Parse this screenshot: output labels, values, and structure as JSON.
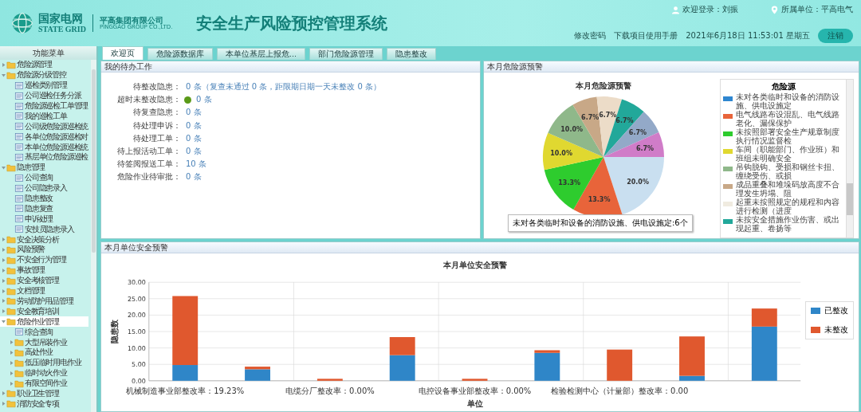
{
  "header": {
    "brand_cn": "国家电网",
    "brand_en": "STATE GRID",
    "company_cn": "平高集团有限公司",
    "company_en": "PINGGAO GROUP CO.,LTD.",
    "title": "安全生产风险预控管理系统",
    "user": "欢迎登录：刘振",
    "unit": "所属单位：平高电气",
    "links": [
      "修改密码",
      "下载项目使用手册"
    ],
    "datetime": "2021年6月18日 11:53:01 星期五",
    "logout": "注销"
  },
  "sidebar": {
    "title": "功能菜单",
    "items": [
      {
        "label": "危险源管理",
        "kind": "folder",
        "expanded": false,
        "selected": false
      },
      {
        "label": "危险源分级管控",
        "kind": "folder",
        "expanded": true,
        "selected": false,
        "children": [
          {
            "label": "巡检类别管理",
            "kind": "page",
            "selected": false
          },
          {
            "label": "公司巡检任务分派",
            "kind": "page",
            "selected": false
          },
          {
            "label": "危险源巡检工单管理",
            "kind": "page",
            "selected": false
          },
          {
            "label": "我的巡检工单",
            "kind": "page",
            "selected": false
          },
          {
            "label": "公司级危险源巡检统",
            "kind": "page",
            "selected": false
          },
          {
            "label": "各单位危险源巡检对",
            "kind": "page",
            "selected": false
          },
          {
            "label": "本单位危险源巡检统",
            "kind": "page",
            "selected": false
          },
          {
            "label": "基层单位危险源巡检",
            "kind": "page",
            "selected": false
          }
        ]
      },
      {
        "label": "隐患管理",
        "kind": "folder",
        "expanded": true,
        "selected": false,
        "children": [
          {
            "label": "公司查询",
            "kind": "page",
            "selected": false
          },
          {
            "label": "公司隐患录入",
            "kind": "page",
            "selected": false
          },
          {
            "label": "隐患整改",
            "kind": "page",
            "selected": false
          },
          {
            "label": "隐患复查",
            "kind": "page",
            "selected": false
          },
          {
            "label": "申诉处理",
            "kind": "page",
            "selected": false
          },
          {
            "label": "安技员隐患录入",
            "kind": "page",
            "selected": false
          }
        ]
      },
      {
        "label": "安全决策分析",
        "kind": "folder",
        "expanded": false,
        "selected": false
      },
      {
        "label": "风险预警",
        "kind": "folder",
        "expanded": false,
        "selected": false
      },
      {
        "label": "不安全行为管理",
        "kind": "folder",
        "expanded": false,
        "selected": false
      },
      {
        "label": "事故管理",
        "kind": "folder",
        "expanded": false,
        "selected": false
      },
      {
        "label": "安全考核管理",
        "kind": "folder",
        "expanded": false,
        "selected": false
      },
      {
        "label": "文档管理",
        "kind": "folder",
        "expanded": false,
        "selected": false
      },
      {
        "label": "劳动防护用品管理",
        "kind": "folder",
        "expanded": false,
        "selected": false
      },
      {
        "label": "安全教育培训",
        "kind": "folder",
        "expanded": false,
        "selected": false
      },
      {
        "label": "危险作业管理",
        "kind": "folder",
        "expanded": true,
        "selected": true,
        "children": [
          {
            "label": "综合查询",
            "kind": "page",
            "selected": false
          },
          {
            "label": "大型吊装作业",
            "kind": "folder",
            "expanded": false,
            "selected": false
          },
          {
            "label": "高处作业",
            "kind": "folder",
            "expanded": false,
            "selected": false
          },
          {
            "label": "低压临时用电作业",
            "kind": "folder",
            "expanded": false,
            "selected": false
          },
          {
            "label": "临时动火作业",
            "kind": "folder",
            "expanded": false,
            "selected": false
          },
          {
            "label": "有限空间作业",
            "kind": "folder",
            "expanded": false,
            "selected": false
          }
        ]
      },
      {
        "label": "职业卫生管理",
        "kind": "folder",
        "expanded": false,
        "selected": false
      },
      {
        "label": "消防安全专项",
        "kind": "folder",
        "expanded": false,
        "selected": false
      }
    ]
  },
  "tabs": [
    {
      "label": "欢迎页",
      "selected": true
    },
    {
      "label": "危险源数据库",
      "selected": false
    },
    {
      "label": "本单位基层上报危...",
      "selected": false
    },
    {
      "label": "部门危险源管理",
      "selected": false
    },
    {
      "label": "隐患整改",
      "selected": false
    }
  ],
  "todo": {
    "title": "我的待办工作",
    "rows": [
      {
        "label": "待整改隐患：",
        "value": "0 条（复查未通过 0 条，距限期日期一天未整改 0 条）",
        "alert": false
      },
      {
        "label": "超时未整改隐患：",
        "value": "0 条",
        "alert": true
      },
      {
        "label": "待复查隐患：",
        "value": "0 条",
        "alert": false
      },
      {
        "label": "待处理申诉：",
        "value": "0 条",
        "alert": false
      },
      {
        "label": "待处理工单：",
        "value": "0 条",
        "alert": false
      },
      {
        "label": "待上报活动工单：",
        "value": "0 条",
        "alert": false
      },
      {
        "label": "待签阅报送工单：",
        "value": "10 条",
        "alert": false
      },
      {
        "label": "危险作业待审批：",
        "value": "0 条",
        "alert": false
      }
    ]
  },
  "hazard_panel": {
    "title": "本月危险源预警",
    "chart_data": {
      "type": "pie",
      "title": "本月危险源预警",
      "values": [
        20.0,
        13.3,
        13.3,
        10.0,
        10.0,
        6.7,
        6.7,
        6.7,
        6.7,
        6.7
      ],
      "colors": [
        "#c9dff0",
        "#e8643a",
        "#2ecc2e",
        "#e0d830",
        "#8fb88a",
        "#c8a887",
        "#ecdcc8",
        "#22a89a",
        "#93a9c8",
        "#d07cc8"
      ],
      "value_labels": [
        "20.0%",
        "13.3%",
        "13.3%",
        "10.0%",
        "10.0%",
        "6.7%",
        "6.7%",
        "6.7%",
        "6.7%",
        "6.7%"
      ]
    },
    "tooltip": "未对各类临时和设备的消防设施、供电设施定:6个",
    "legend": {
      "title": "危险源",
      "items": [
        {
          "label": "未对各类临时和设备的消防设施、供电设施定",
          "color": "#2e86d0"
        },
        {
          "label": "电气线路布设混乱、电气线路老化、漏保保护",
          "color": "#e8643a"
        },
        {
          "label": "未按照部署安全生产规章制度执行情况监督检",
          "color": "#2ecc2e"
        },
        {
          "label": "车间（职能部门、作业班）和班组未明确安全",
          "color": "#e0d830"
        },
        {
          "label": "吊钩脱钩、受损和钢丝卡扭、缠绕受伤、或损",
          "color": "#8fb88a"
        },
        {
          "label": "成品重叠和堆垛码放高度不合理发生坍塌、阻",
          "color": "#c8a887"
        },
        {
          "label": "起重未按照规定的规程和内容进行检测（进度",
          "color": "#f0ebe0"
        },
        {
          "label": "未按安全措施作业伤害、或出现起重、卷扬等",
          "color": "#22a89a"
        }
      ]
    }
  },
  "unit_panel": {
    "title": "本月单位安全预警",
    "chart_data": {
      "type": "bar",
      "title": "本月单位安全预警",
      "xlabel": "单位",
      "ylabel": "隐患数",
      "stacked": true,
      "grid": true,
      "legend": true,
      "categories": [
        "机械制造事业部整改率：19.23%",
        null,
        "电缆分厂整改率：0.00%",
        null,
        "电控设备事业部整改率：0.00%",
        null,
        "检验检测中心（计量部）整改率：0.00",
        null,
        null
      ],
      "ylim": [
        0,
        30
      ],
      "yticks": [
        {
          "value": 0,
          "label": "0.00"
        },
        {
          "value": 5,
          "label": "5.00"
        },
        {
          "value": 10,
          "label": "10.00"
        },
        {
          "value": 15,
          "label": "15.00"
        },
        {
          "value": 20,
          "label": "20.00"
        },
        {
          "value": 25,
          "label": "25.00"
        },
        {
          "value": 30,
          "label": "30.00"
        }
      ],
      "series": [
        {
          "name": "已整改",
          "color": "#2f86c8",
          "values": [
            4.8,
            3.5,
            0,
            7.8,
            0,
            8.5,
            0,
            1.5,
            16.5
          ]
        },
        {
          "name": "未整改",
          "color": "#e0582e",
          "values": [
            21,
            0.8,
            0.6,
            5.5,
            0.6,
            0.8,
            9.5,
            12,
            5.5
          ]
        }
      ]
    }
  }
}
